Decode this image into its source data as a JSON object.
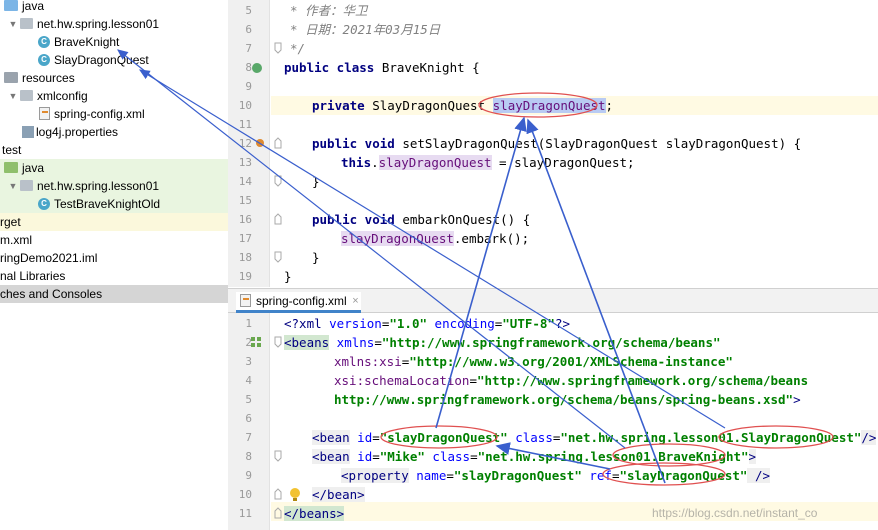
{
  "tree": {
    "items": [
      {
        "label": "java",
        "icon": "folder-blue"
      },
      {
        "label": "net.hw.spring.lesson01",
        "icon": "package"
      },
      {
        "label": "BraveKnight",
        "icon": "class"
      },
      {
        "label": "SlayDragonQuest",
        "icon": "class"
      },
      {
        "label": "resources",
        "icon": "folder-gray"
      },
      {
        "label": "xmlconfig",
        "icon": "package"
      },
      {
        "label": "spring-config.xml",
        "icon": "xml-file"
      },
      {
        "label": "log4j.properties",
        "icon": "properties-file"
      },
      {
        "label": "test",
        "icon": "none"
      },
      {
        "label": "java",
        "icon": "folder-green"
      },
      {
        "label": "net.hw.spring.lesson01",
        "icon": "package"
      },
      {
        "label": "TestBraveKnightOld",
        "icon": "class"
      },
      {
        "label": "rget",
        "icon": "none"
      },
      {
        "label": "m.xml",
        "icon": "none"
      },
      {
        "label": "ringDemo2021.iml",
        "icon": "none"
      },
      {
        "label": "nal Libraries",
        "icon": "none"
      },
      {
        "label": "ches and Consoles",
        "icon": "none"
      }
    ]
  },
  "java_editor": {
    "line_numbers": [
      "5",
      "6",
      "7",
      "8",
      "9",
      "10",
      "11",
      "12",
      "13",
      "14",
      "15",
      "16",
      "17",
      "18",
      "19"
    ],
    "lines": {
      "l5": "* 作者：华卫",
      "l6": "* 日期：2021年03月15日",
      "l7": "*/",
      "l8_kw": "public class ",
      "l8_rest": "BraveKnight {",
      "l10_kw": "private ",
      "l10_type": "SlayDragonQuest ",
      "l10_field": "slayDragonQuest",
      "l10_end": ";",
      "l12_kw": "public void ",
      "l12_rest": "setSlayDragonQuest(SlayDragonQuest slayDragonQuest) {",
      "l13_kw": "this",
      "l13_dot": ".",
      "l13_field": "slayDragonQuest",
      "l13_rest": " = slayDragonQuest;",
      "l14": "}",
      "l16_kw": "public void ",
      "l16_rest": "embarkOnQuest() {",
      "l17_field": "slayDragonQuest",
      "l17_rest": ".embark();",
      "l18": "}",
      "l19": "}"
    }
  },
  "tab": {
    "label": "spring-config.xml",
    "close": "×"
  },
  "xml_editor": {
    "line_numbers": [
      "1",
      "2",
      "3",
      "4",
      "5",
      "6",
      "7",
      "8",
      "9",
      "10",
      "11"
    ],
    "lines": {
      "l1_a": "<?xml ",
      "l1_b": "version",
      "l1_c": "=",
      "l1_d": "\"1.0\"",
      "l1_e": " encoding",
      "l1_f": "=",
      "l1_g": "\"UTF-8\"",
      "l1_h": "?>",
      "l2_tag": "<beans",
      "l2_attr": " xmlns",
      "l2_eq": "=",
      "l2_val": "\"http://www.springframework.org/schema/beans\"",
      "l3_attr": "xmlns:xsi",
      "l3_eq": "=",
      "l3_val": "\"http://www.w3.org/2001/XMLSchema-instance\"",
      "l4_attr": "xsi:schemaLocation",
      "l4_eq": "=",
      "l4_val": "\"http://www.springframework.org/schema/beans",
      "l5_val": "http://www.springframework.org/schema/beans/spring-beans.xsd\"",
      "l5_end": ">",
      "l7_tag": "<bean",
      "l7_a1": " id",
      "l7_eq1": "=",
      "l7_v1": "\"slayDragonQuest\"",
      "l7_a2": " class",
      "l7_eq2": "=",
      "l7_v2": "\"net.hw.spring.lesson01.SlayDragonQuest\"",
      "l7_end": "/>",
      "l8_tag": "<bean",
      "l8_a1": " id",
      "l8_eq1": "=",
      "l8_v1": "\"Mike\"",
      "l8_a2": " class",
      "l8_eq2": "=",
      "l8_v2": "\"net.hw.spring.lesson01.BraveKnight\"",
      "l8_end": ">",
      "l9_tag": "<property",
      "l9_a1": " name",
      "l9_eq1": "=",
      "l9_v1": "\"slayDragonQuest\"",
      "l9_a2": " ref",
      "l9_eq2": "=",
      "l9_v2": "\"slayDragonQuest\"",
      "l9_end": " />",
      "l10": "</bean>",
      "l11": "</beans>"
    }
  },
  "watermark": "https://blog.csdn.net/instant_co",
  "colors": {
    "annotation_blue": "#3a5fcd",
    "annotation_red": "#e05050",
    "keyword": "#000080",
    "string": "#008000",
    "field": "#660e7a"
  }
}
